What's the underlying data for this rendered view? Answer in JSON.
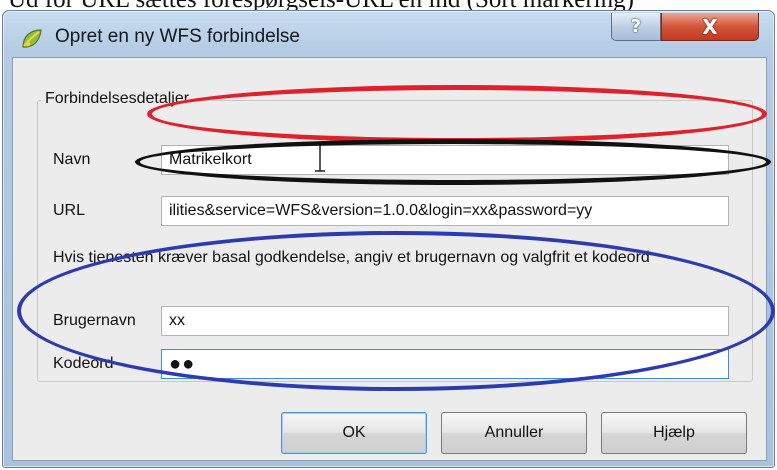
{
  "caption": {
    "text": "Ud for URL sættes forespørgsels-URL'en ind (Sort markering)"
  },
  "window": {
    "title": "Opret en ny WFS forbindelse",
    "app_icon": "qgis-icon",
    "help_button_glyph": "?",
    "close_button_glyph": "X"
  },
  "group": {
    "title": "Forbindelsesdetaljer"
  },
  "fields": {
    "name_label": "Navn",
    "name_value": "Matrikelkort",
    "url_label": "URL",
    "url_value": "ilities&service=WFS&version=1.0.0&login=xx&password=yy",
    "info_text": "Hvis tjenesten kræver basal godkendelse, angiv et brugernavn og valgfrit et kodeord",
    "username_label": "Brugernavn",
    "username_value": "xx",
    "password_label": "Kodeord",
    "password_value": "●●"
  },
  "buttons": {
    "ok": "OK",
    "cancel": "Annuller",
    "help": "Hjælp"
  },
  "annotations": {
    "name_highlight_color": "#e0202a",
    "url_highlight_color": "#111111",
    "credentials_highlight_color": "#2d3ab0"
  }
}
